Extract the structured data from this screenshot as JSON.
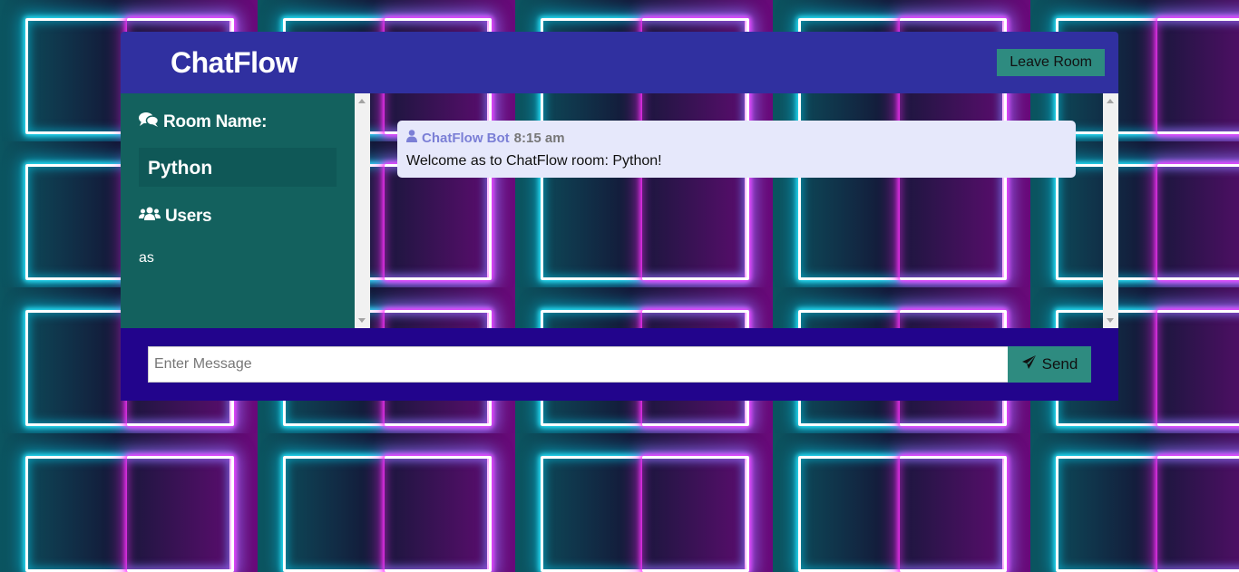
{
  "header": {
    "logo": "ChatFlow",
    "leave_label": "Leave Room"
  },
  "sidebar": {
    "room_title": "Room Name:",
    "room_name": "Python",
    "users_title": "Users",
    "users": [
      "as"
    ]
  },
  "messages": [
    {
      "author": "ChatFlow Bot",
      "time": "8:15 am",
      "text": "Welcome as to ChatFlow room: Python!"
    }
  ],
  "composer": {
    "placeholder": "Enter Message",
    "send_label": "Send"
  },
  "colors": {
    "header": "#3030a0",
    "sidebar": "#13615e",
    "footer": "#22048c",
    "accent": "#2e8b80",
    "message_bg": "#e6e8fb"
  }
}
